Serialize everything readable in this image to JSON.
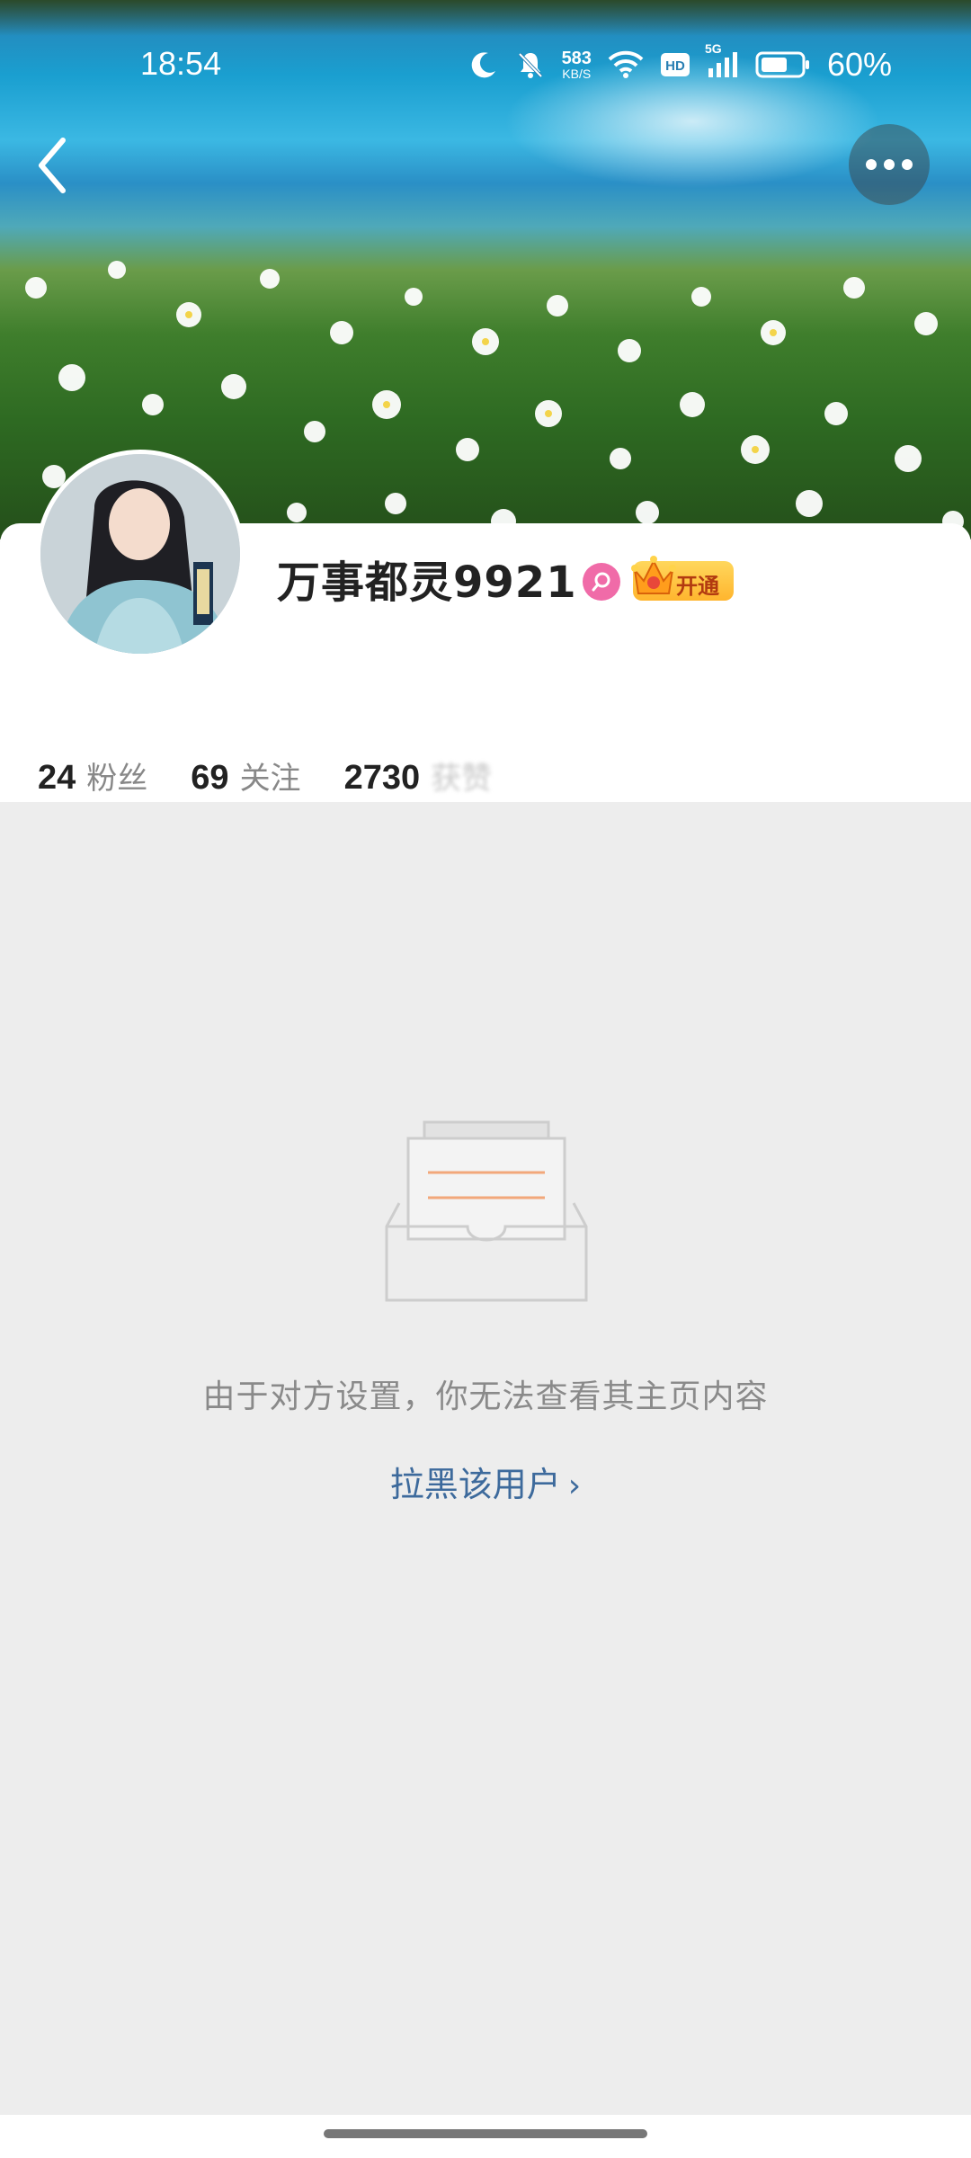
{
  "status_bar": {
    "time": "18:54",
    "net_speed_value": "583",
    "net_speed_unit": "KB/S",
    "hd_label": "HD",
    "network_label": "5G",
    "battery_percent": "60%",
    "icons": [
      "moon-icon",
      "bell-off-icon",
      "wifi-icon",
      "hd-icon",
      "signal-icon",
      "battery-icon"
    ]
  },
  "header": {
    "back_icon": "chevron-left-icon",
    "more_icon": "more-dots-icon"
  },
  "profile": {
    "nickname": "万事都灵9921",
    "gender": "female",
    "vip_label": "开通",
    "stats": [
      {
        "value": "24",
        "label": "粉丝"
      },
      {
        "value": "69",
        "label": "关注"
      },
      {
        "value": "2730",
        "label": "获赞"
      }
    ]
  },
  "empty_state": {
    "icon": "empty-box-icon",
    "message": "由于对方设置，你无法查看其主页内容",
    "action_label": "拉黑该用户",
    "action_icon": "chevron-right-icon"
  },
  "colors": {
    "page_background": "#ededed",
    "link": "#3d6a9c",
    "gender_badge": "#f06ba8",
    "vip_gold": "#ffc23a"
  }
}
